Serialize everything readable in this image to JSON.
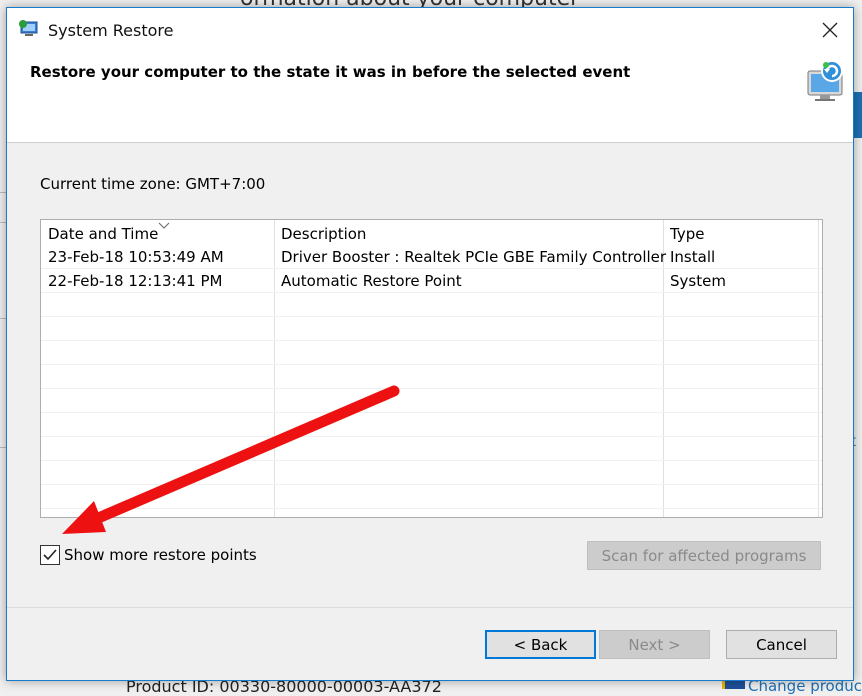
{
  "background": {
    "top_text": "ormation about your computer",
    "bottom_text": "Product ID: 00330-80000-00003-AA372",
    "right_fragment": "t",
    "bottom_link_fragment": "Change product"
  },
  "dialog": {
    "title": "System Restore",
    "header_title": "Restore your computer to the state it was in before the selected event",
    "timezone": "Current time zone: GMT+7:00",
    "columns": {
      "date": "Date and Time",
      "description": "Description",
      "type": "Type"
    },
    "rows": [
      {
        "date": "23-Feb-18 10:53:49 AM",
        "description": "Driver Booster : Realtek PCIe GBE Family Controller",
        "type": "Install"
      },
      {
        "date": "22-Feb-18 12:13:41 PM",
        "description": "Automatic Restore Point",
        "type": "System"
      }
    ],
    "show_more_label": "Show more restore points",
    "show_more_checked": true,
    "scan_label": "Scan for affected programs",
    "back_label": "< Back",
    "next_label": "Next >",
    "cancel_label": "Cancel"
  },
  "colors": {
    "accent": "#0078d7",
    "annotation_arrow": "#ee1111"
  }
}
